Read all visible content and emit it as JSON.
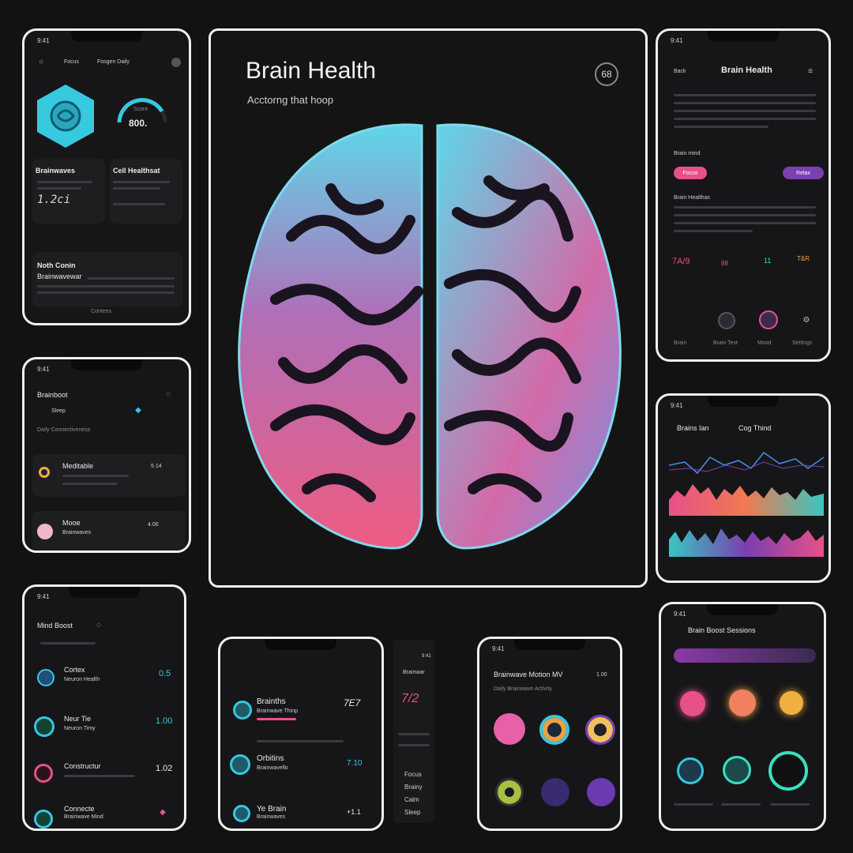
{
  "colors": {
    "bg": "#121212",
    "cyan": "#38c6e0",
    "pink": "#e8508a",
    "purple": "#7a3fb0",
    "orange": "#f0a040"
  },
  "phone_tl": {
    "status": "9:41",
    "tab_a": "Focus",
    "tab_b": "Fosgen Daily",
    "gauge_value": "800.",
    "gauge_label": "Score",
    "card1_title": "Brainwaves",
    "card1_value": "1.2ci",
    "card2_title": "Cell Healthsat",
    "card3_title": "Noth Conin",
    "card3_sub": "Brainwavewar",
    "footer": "Contens"
  },
  "main": {
    "title": "Brain Health",
    "subtitle": "Acctorng that hoop",
    "badge": "68"
  },
  "phone_tr": {
    "status": "9:41",
    "back": "Back",
    "title": "Brain Health",
    "section_a": "Brain mind",
    "btn_a": "Focus",
    "btn_b": "Relax",
    "section_b": "Brain Healthas",
    "stat_a": "7A/9",
    "stat_b": "88",
    "stat_c": "11",
    "stat_d": "T&R",
    "nav_a": "Brain",
    "nav_b": "Brain Test",
    "nav_c": "Mood",
    "nav_d": "Settings"
  },
  "phone_ml": {
    "status": "9:41",
    "header": "Brainboot",
    "sub": "Sleep",
    "tabs": "Daily    Connectiveness",
    "row1_title": "Meditable",
    "row1_value": "5.14",
    "row2_title": "Mooe",
    "row2_sub": "Brainwaves",
    "row2_value": "4.06"
  },
  "phone_mr": {
    "status": "9:41",
    "label_a": "Brains Ian",
    "label_b": "Cog Thind"
  },
  "phone_bl": {
    "status": "9:41",
    "header": "Mind Boost",
    "rows": [
      {
        "title": "Cortex",
        "sub": "Neuron Health",
        "value": "0.5"
      },
      {
        "title": "Neur Tie",
        "sub": "Neuron Timy",
        "value": "1.00"
      },
      {
        "title": "Constructur",
        "sub": "",
        "value": "1.02"
      },
      {
        "title": "Connecte",
        "sub": "Brainwave Mind",
        "value": ""
      }
    ]
  },
  "phone_bc": {
    "rows": [
      {
        "title": "Brainths",
        "sub": "Brainwave Thinp",
        "value": "7E7"
      },
      {
        "title": "Orbitins",
        "sub": "Brainwavello",
        "value": "7.10"
      },
      {
        "title": "Ye Brain",
        "sub": "Brainwaves",
        "value": "+1.1"
      }
    ],
    "side_status": "9:41",
    "side_header": "Brainwar",
    "side_value": "7/2",
    "side_list": [
      "Focus",
      "Brainy",
      "Calm",
      "Sleep"
    ]
  },
  "phone_b3": {
    "status": "9:41",
    "header": "Brainwave Motion MV",
    "header_value": "1.00",
    "sub": "Daily Brainwave Activity"
  },
  "phone_br": {
    "status": "9:41",
    "header": "Brain Boost Sessions"
  }
}
